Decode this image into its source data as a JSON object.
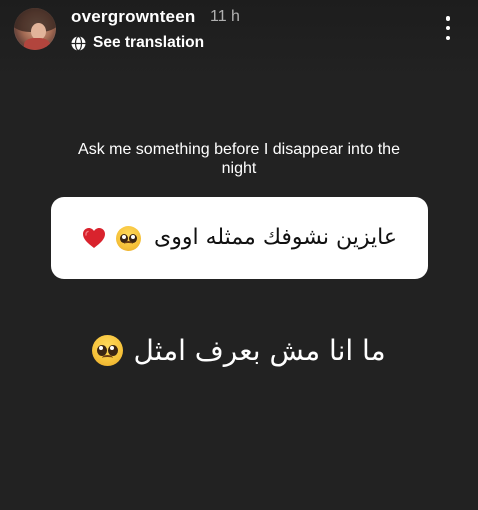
{
  "story": {
    "username": "overgrownteen",
    "time_ago": "11 h",
    "translation_label": "See translation"
  },
  "question_sticker": {
    "prompt": "Ask me something before I disappear into the night",
    "response": "عايزين نشوفك ممثله اووى"
  },
  "caption": {
    "text": "ما انا مش بعرف امثل"
  },
  "icons": {
    "avatar": "profile-photo",
    "translation": "language-globe-icon",
    "more": "more-options-vertical-icon",
    "response_emojis": [
      "pleading-face-emoji",
      "red-heart-emoji"
    ],
    "caption_emoji": "pleading-face-emoji"
  },
  "colors": {
    "background": "#222222",
    "card": "#ffffff",
    "heart": "#d9232d"
  }
}
